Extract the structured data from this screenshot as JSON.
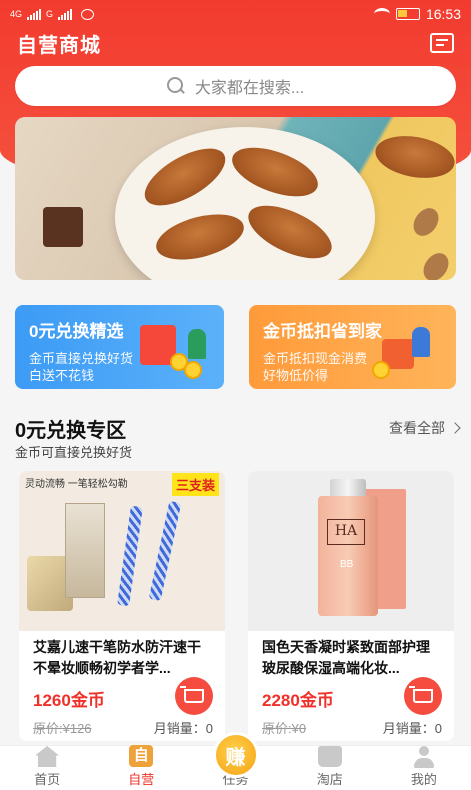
{
  "status_bar": {
    "network_left": "4G",
    "network_right": "G",
    "time": "16:53"
  },
  "header": {
    "title": "自营商城"
  },
  "search": {
    "placeholder": "大家都在搜索..."
  },
  "promos": [
    {
      "title": "0元兑换精选",
      "subtitle": "金币直接兑换好货 白送不花钱",
      "color": "#3c9bf5"
    },
    {
      "title": "金币抵扣省到家",
      "subtitle": "金币抵扣现金消费 好物低价得",
      "color": "#ff9a3a"
    }
  ],
  "section": {
    "title": "0元兑换专区",
    "subtitle": "金币可直接兑换好货",
    "more": "查看全部"
  },
  "products": [
    {
      "name": "艾嘉儿速干笔防水防汗速干不晕妆顺畅初学者学...",
      "price": "1260金币",
      "original": "原价:¥126",
      "sales": "月销量：0",
      "image_slogan": "灵动流畅 一笔轻松勾勒",
      "image_badge": "三支装"
    },
    {
      "name": "国色天香凝时紧致面部护理玻尿酸保湿高端化妆...",
      "price": "2280金币",
      "original": "原价:¥0",
      "sales": "月销量：0",
      "image_logo": "HA",
      "image_label": "BB"
    }
  ],
  "tabbar": {
    "items": [
      {
        "label": "首页",
        "icon": "home-icon"
      },
      {
        "label": "自营",
        "icon": "self-icon",
        "icon_text": "自"
      },
      {
        "label": "任务",
        "icon": "earn-icon",
        "icon_text": "赚"
      },
      {
        "label": "淘店",
        "icon": "shop-icon"
      },
      {
        "label": "我的",
        "icon": "user-icon"
      }
    ],
    "active_index": 1,
    "accent": "#f0312a"
  }
}
